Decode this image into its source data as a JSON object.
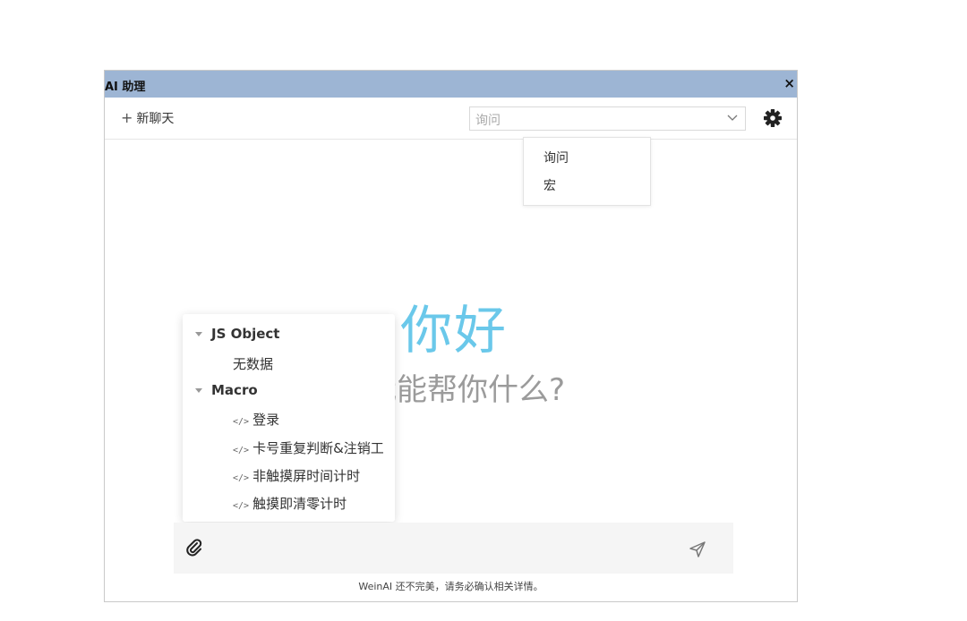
{
  "window": {
    "title": "AI 助理",
    "close_label": "×"
  },
  "toolbar": {
    "new_chat_plus": "+",
    "new_chat_label": "新聊天",
    "mode_value": "询问"
  },
  "mode_dropdown": {
    "options": [
      "询问",
      "宏"
    ]
  },
  "greeting": {
    "title": "你好",
    "subtitle": "我能帮你什么?"
  },
  "tree": {
    "groups": [
      {
        "label": "JS Object",
        "empty_text": "无数据"
      },
      {
        "label": "Macro",
        "items": [
          "登录",
          "卡号重复判断&注销工",
          "非触摸屏时间计时",
          "触摸即清零计时"
        ]
      }
    ],
    "code_glyph": "</>"
  },
  "footer": {
    "disclaimer": "WeinAI 还不完美，请务必确认相关详情。"
  },
  "colors": {
    "titlebar": "#9db5d4",
    "greeting": "#6ac8ea",
    "subgreeting": "#9b9b9b",
    "input_bg": "#f5f5f5"
  },
  "icons": [
    "close-icon",
    "plus-icon",
    "chevron-down-icon",
    "gear-icon",
    "caret-down-icon",
    "code-icon",
    "paperclip-icon",
    "send-icon"
  ]
}
